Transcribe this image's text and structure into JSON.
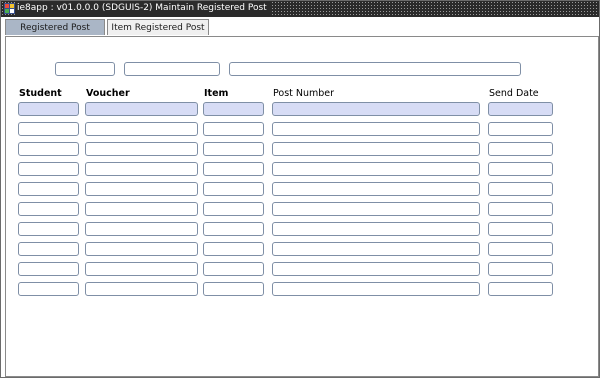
{
  "window": {
    "title": "ie8app : v01.0.0.0 (SDGUIS-2) Maintain Registered Post",
    "icon": "app-icon"
  },
  "tabs": [
    {
      "label": "Registered Post",
      "active": true
    },
    {
      "label": "Item Registered Post",
      "active": false
    }
  ],
  "columns": {
    "student": "Student",
    "voucher": "Voucher",
    "item": "Item",
    "post_number": "Post Number",
    "send_date": "Send Date"
  },
  "colors": {
    "field_border": "#7f8fa6",
    "highlight_fill": "#d7dcf5",
    "active_tab": "#aab6c6"
  }
}
